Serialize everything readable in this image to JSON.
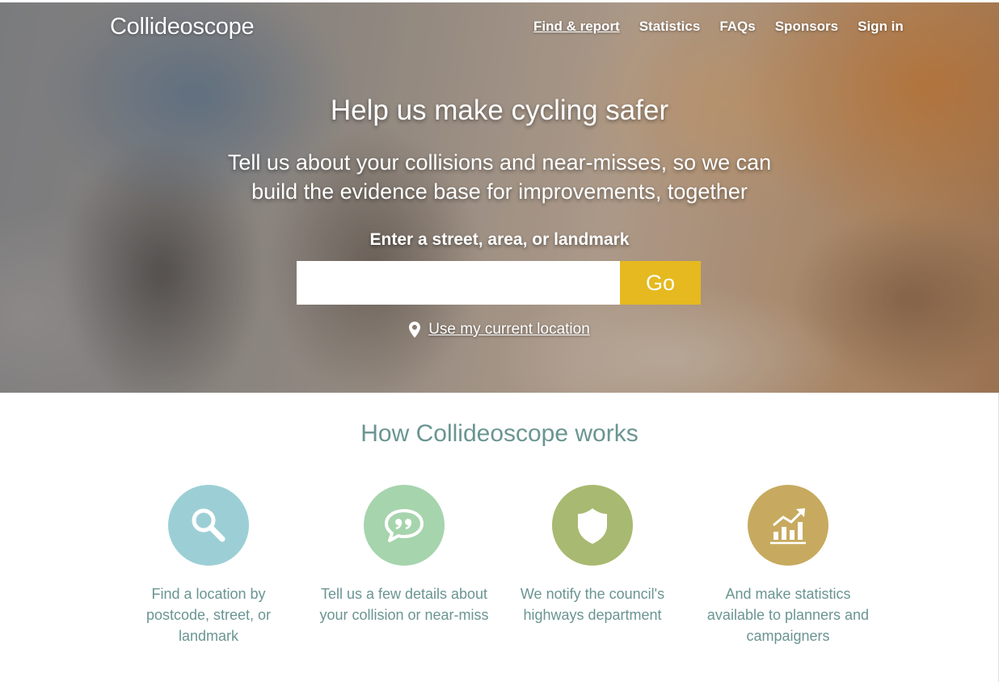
{
  "header": {
    "logo": "Collideoscope",
    "nav": [
      {
        "label": "Find & report",
        "active": true
      },
      {
        "label": "Statistics",
        "active": false
      },
      {
        "label": "FAQs",
        "active": false
      },
      {
        "label": "Sponsors",
        "active": false
      },
      {
        "label": "Sign in",
        "active": false
      }
    ]
  },
  "hero": {
    "title": "Help us make cycling safer",
    "subtitle": "Tell us about your collisions and near-misses, so we can build the evidence base for improvements, together",
    "search_label": "Enter a street, area, or landmark",
    "search_value": "",
    "go_label": "Go",
    "go_color": "#e5b91f",
    "current_location_icon": "map-pin-icon",
    "current_location_label": "Use my current location"
  },
  "how_it_works": {
    "title": "How Collideoscope works",
    "steps": [
      {
        "icon": "search-icon",
        "color": "#9ccfd5",
        "caption": "Find a location by postcode, street, or landmark"
      },
      {
        "icon": "speech-quote-icon",
        "color": "#a6d4ad",
        "caption": "Tell us a few details about your collision or near-miss"
      },
      {
        "icon": "shield-icon",
        "color": "#a8b971",
        "caption": "We notify the council's highways department"
      },
      {
        "icon": "chart-trend-icon",
        "color": "#c7aa5f",
        "caption": "And make statistics available to planners and campaigners"
      }
    ]
  }
}
